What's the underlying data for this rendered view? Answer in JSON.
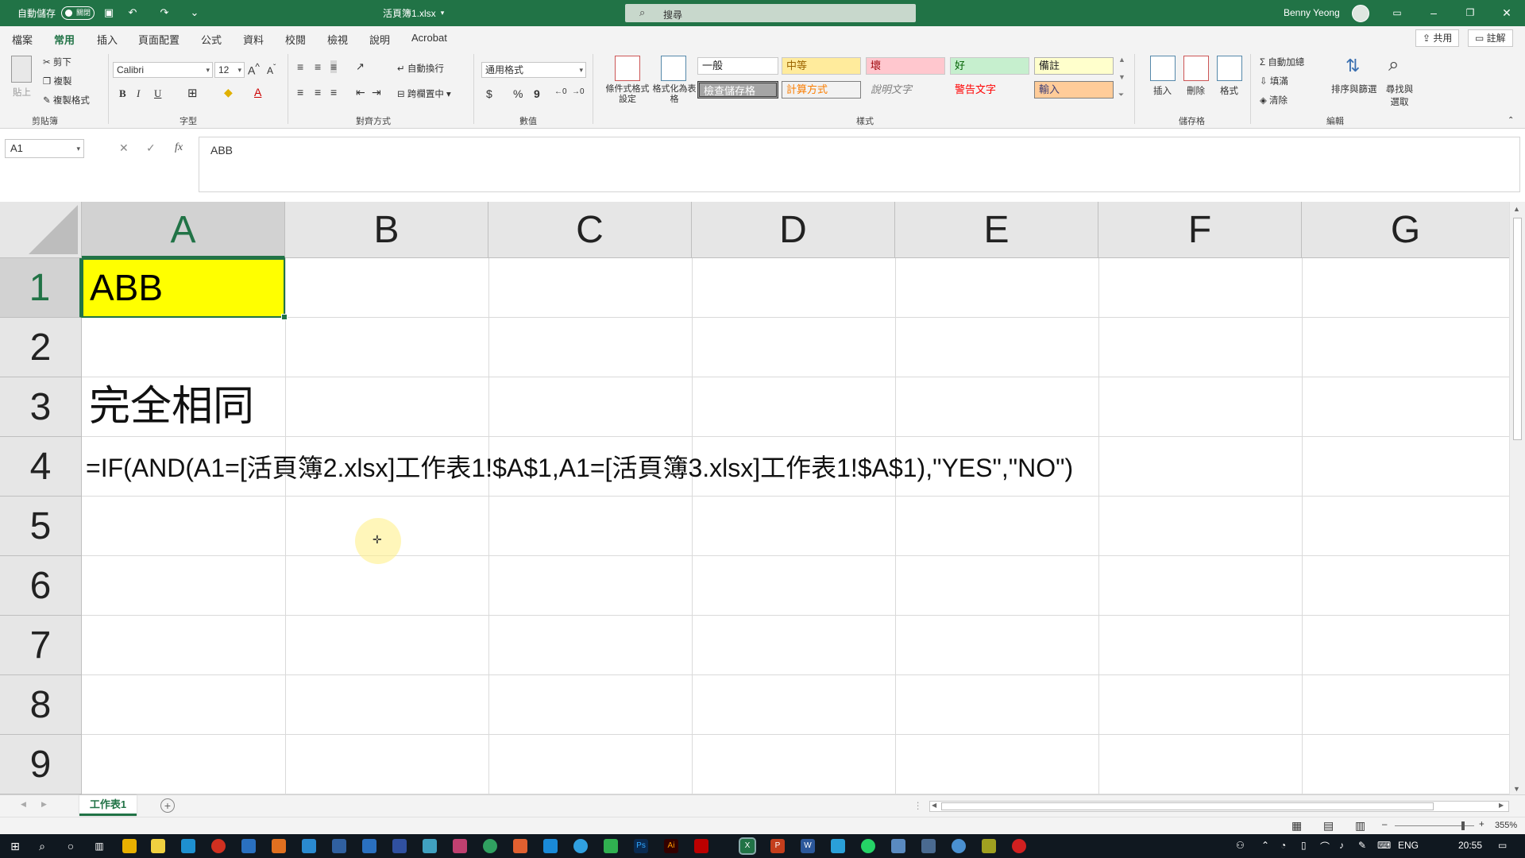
{
  "titlebar": {
    "autosave_label": "自動儲存",
    "autosave_state": "關閉",
    "filename": "活頁簿1.xlsx",
    "search_placeholder": "搜尋",
    "user_name": "Benny Yeong"
  },
  "menu": {
    "tabs": [
      "檔案",
      "常用",
      "插入",
      "頁面配置",
      "公式",
      "資料",
      "校閱",
      "檢視",
      "說明",
      "Acrobat"
    ],
    "active": "常用",
    "share": "共用",
    "comments": "註解"
  },
  "ribbon": {
    "clipboard": {
      "paste": "貼上",
      "cut": "剪下",
      "copy": "複製",
      "format_painter": "複製格式",
      "label": "剪貼簿"
    },
    "font": {
      "name": "Calibri",
      "size": "12",
      "bold": "B",
      "italic": "I",
      "underline": "U",
      "label": "字型"
    },
    "alignment": {
      "wrap": "自動換行",
      "merge": "跨欄置中",
      "label": "對齊方式"
    },
    "number": {
      "format": "通用格式",
      "currency": "$",
      "percent": "%",
      "comma": "9",
      "label": "數值"
    },
    "styles": {
      "conditional": "條件式格式設定",
      "as_table": "格式化為表格",
      "cells": [
        "一般",
        "中等",
        "壞",
        "好",
        "備註",
        "檢查儲存格",
        "計算方式",
        "說明文字",
        "警告文字",
        "輸入"
      ],
      "label": "樣式"
    },
    "cells_grp": {
      "insert": "插入",
      "delete": "刪除",
      "format": "格式",
      "label": "儲存格"
    },
    "editing": {
      "autosum": "自動加總",
      "fill": "填滿",
      "clear": "清除",
      "sort": "排序與篩選",
      "find": "尋找與選取",
      "label": "編輯"
    }
  },
  "formula": {
    "namebox": "A1",
    "content": "ABB"
  },
  "grid": {
    "columns": [
      "A",
      "B",
      "C",
      "D",
      "E",
      "F",
      "G"
    ],
    "rows": [
      "1",
      "2",
      "3",
      "4",
      "5",
      "6",
      "7",
      "8",
      "9"
    ],
    "A1": "ABB",
    "A3": "完全相同",
    "A4": "=IF(AND(A1=[活頁簿2.xlsx]工作表1!$A$1,A1=[活頁簿3.xlsx]工作表1!$A$1),\"YES\",\"NO\")"
  },
  "sheets": {
    "active": "工作表1"
  },
  "status": {
    "zoom": "355%"
  },
  "taskbar": {
    "lang": "ENG",
    "time": "20:55"
  },
  "colors": {
    "excel_green": "#217346",
    "highlight": "#ffff00"
  }
}
